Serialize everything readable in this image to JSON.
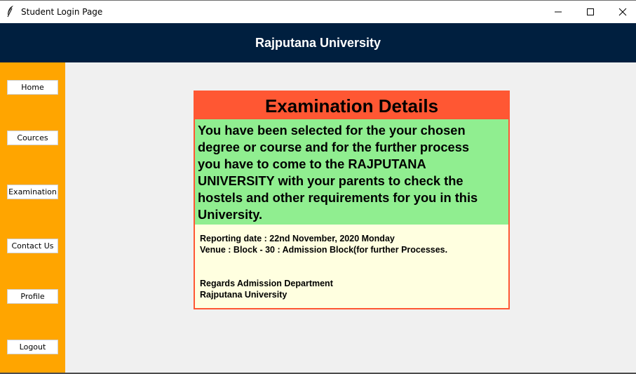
{
  "window": {
    "title": "Student Login Page",
    "icon": "feather-icon"
  },
  "header": {
    "title": "Rajputana University"
  },
  "sidebar": {
    "items": [
      {
        "label": "Home"
      },
      {
        "label": "Cources"
      },
      {
        "label": "Examination"
      },
      {
        "label": "Contact Us"
      },
      {
        "label": "Profile"
      },
      {
        "label": "Logout"
      }
    ]
  },
  "card": {
    "title": "Examination Details",
    "message": "You have been selected for the your chosen\n degree or course and for the further process\n you have to come to the RAJPUTANA\n UNIVERSITY with your parents to check the\n hostels and other requirements for you in this\n University.",
    "reporting": "Reporting date : 22nd November, 2020 Monday",
    "venue": "Venue : Block - 30 : Admission Block(for further Processes.",
    "regards": "Regards Admission Department",
    "university": "Rajputana University"
  },
  "colors": {
    "header_bg": "#001f3f",
    "sidebar_bg": "#ffa500",
    "card_title_bg": "#ff5733",
    "card_message_bg": "#90ee90",
    "card_info_bg": "#ffffe0"
  }
}
